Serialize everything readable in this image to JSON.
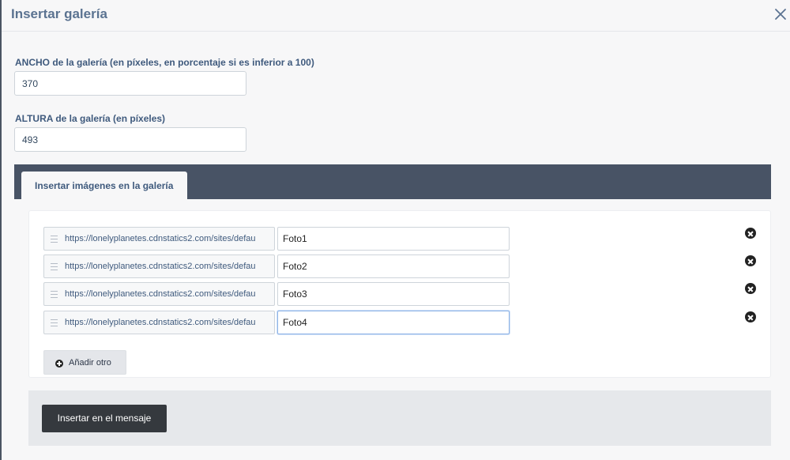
{
  "dialog": {
    "title": "Insertar galería"
  },
  "width_field": {
    "label": "ANCHO de la galería (en píxeles, en porcentaje si es inferior a 100)",
    "value": "370"
  },
  "height_field": {
    "label": "ALTURA de la galería (en píxeles)",
    "value": "493"
  },
  "images_tab": {
    "label": "Insertar imágenes en la galería"
  },
  "images": [
    {
      "url": "https://lonelyplanetes.cdnstatics2.com/sites/defau",
      "caption": "Foto1"
    },
    {
      "url": "https://lonelyplanetes.cdnstatics2.com/sites/defau",
      "caption": "Foto2"
    },
    {
      "url": "https://lonelyplanetes.cdnstatics2.com/sites/defau",
      "caption": "Foto3"
    },
    {
      "url": "https://lonelyplanetes.cdnstatics2.com/sites/defau",
      "caption": "Foto4"
    }
  ],
  "add_button": {
    "label": "Añadir otro"
  },
  "submit_button": {
    "label": "Insertar en el mensaje"
  },
  "icons": {
    "close": "close-icon",
    "drag": "drag-handle-icon",
    "remove": "remove-circle-icon",
    "add": "plus-circle-icon"
  },
  "colors": {
    "title": "#5b7391",
    "tab_bar": "#485365",
    "submit": "#35393e"
  }
}
